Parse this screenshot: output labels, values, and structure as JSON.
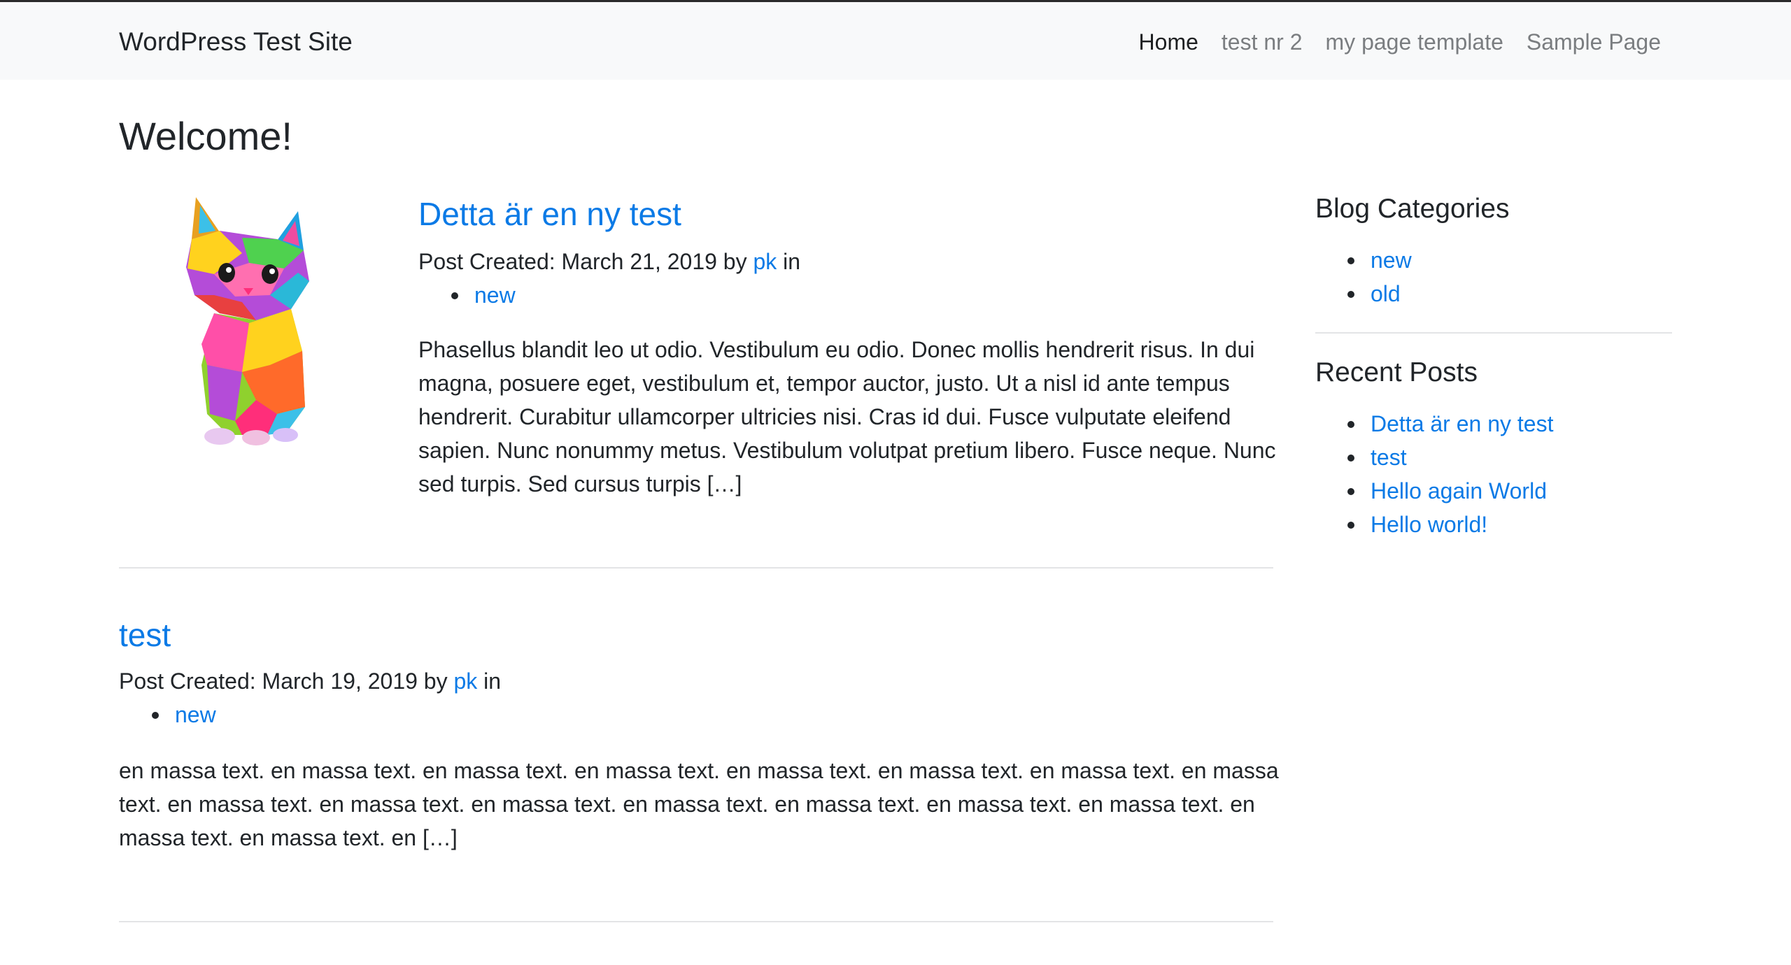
{
  "site": {
    "title": "WordPress Test Site"
  },
  "nav": {
    "items": [
      {
        "label": "Home"
      },
      {
        "label": "test nr 2"
      },
      {
        "label": "my page template"
      },
      {
        "label": "Sample Page"
      }
    ]
  },
  "page": {
    "heading": "Welcome!"
  },
  "posts": [
    {
      "title": "Detta är en ny test",
      "meta_prefix": "Post Created: March 21, 2019 by ",
      "author": "pk",
      "meta_suffix": " in",
      "categories": [
        "new"
      ],
      "excerpt": "Phasellus blandit leo ut odio. Vestibulum eu odio. Donec mollis hendrerit risus. In dui magna, posuere eget, vestibulum et, tempor auctor, justo. Ut a nisl id ante tempus hendrerit. Curabitur ullamcorper ultricies nisi. Cras id dui. Fusce vulputate eleifend sapien. Nunc nonummy metus. Vestibulum volutpat pretium libero. Fusce neque. Nunc sed turpis. Sed cursus turpis […]",
      "thumbnail": "colorful-cat-icon"
    },
    {
      "title": "test",
      "meta_prefix": "Post Created: March 19, 2019 by ",
      "author": "pk",
      "meta_suffix": " in",
      "categories": [
        "new"
      ],
      "excerpt": "en massa text. en massa text. en massa text. en massa text. en massa text. en massa text. en massa text. en massa text. en massa text. en massa text. en massa text. en massa text. en massa text. en massa text. en massa text. en massa text. en massa text. en […]"
    }
  ],
  "sidebar": {
    "categories_heading": "Blog Categories",
    "categories": [
      "new",
      "old"
    ],
    "recent_heading": "Recent Posts",
    "recent": [
      "Detta är en ny test",
      "test",
      "Hello again World",
      "Hello world!"
    ]
  },
  "colors": {
    "link": "#0b7ae6",
    "navbar_bg": "#f8f9fa",
    "text": "#212529"
  }
}
